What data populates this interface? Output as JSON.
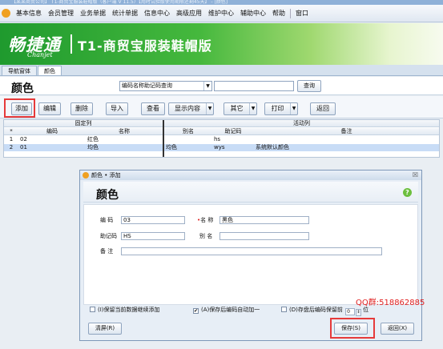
{
  "window": {
    "title": "【某某商贸公司】 T1-商贸宝服装鞋帽版（客户端 V 11.5）【用时试验版使用期限还剩45天】 - [颜色]"
  },
  "menubar": [
    "基本信息",
    "会员管理",
    "业务单据",
    "统计单据",
    "信息中心",
    "高级应用",
    "维护中心",
    "辅助中心",
    "帮助",
    "窗口"
  ],
  "banner": {
    "brand": "畅捷通",
    "brand_en": "Chanjet",
    "product": "T1-商贸宝服装鞋帽版"
  },
  "tabs": [
    {
      "label": "导航窗体"
    },
    {
      "label": "颜色"
    }
  ],
  "page": {
    "title": "颜色",
    "search_mode": "编码名称助记码查询",
    "search_value": "",
    "search_button": "查询"
  },
  "toolbar": {
    "add": "添加",
    "edit": "编辑",
    "delete": "删除",
    "import": "导入",
    "view": "查看",
    "display": "显示内容",
    "other": "其它",
    "print": "打印",
    "back": "返回"
  },
  "grid": {
    "group_fixed": "固定列",
    "group_active": "活动列",
    "row_marker": "*",
    "columns": {
      "code": "编码",
      "name": "名称",
      "alias": "别名",
      "mnemonic": "助记码",
      "note": "备注"
    },
    "rows": [
      {
        "no": "1",
        "code": "02",
        "name": "红色",
        "alias": "",
        "mnemonic": "hs",
        "note": ""
      },
      {
        "no": "2",
        "code": "01",
        "name": "均色",
        "alias": "均色",
        "mnemonic": "wys",
        "note": "系统默认颜色"
      }
    ]
  },
  "dialog": {
    "title": "颜色 • 添加",
    "close": "☒",
    "heading": "颜色",
    "help": "?",
    "fields": {
      "code_label": "编  码",
      "code_value": "03",
      "name_label": "名  称",
      "name_value": "黑色",
      "mnemonic_label": "助记码",
      "mnemonic_value": "HS",
      "alias_label": "别  名",
      "alias_value": "",
      "note_label": "备  注",
      "note_value": ""
    },
    "watermark": "QQ群:518862885",
    "options": {
      "keep_data": "(I)保留当前数据继续添加",
      "auto_increment": "(A)保存后编码自动加一",
      "keep_prefix_before": "(D)存盘后编码保留前",
      "keep_prefix_count": "0",
      "keep_prefix_after": "位"
    },
    "buttons": {
      "clear": "清屏(R)",
      "save": "保存(S)",
      "back": "返回(X)"
    }
  }
}
